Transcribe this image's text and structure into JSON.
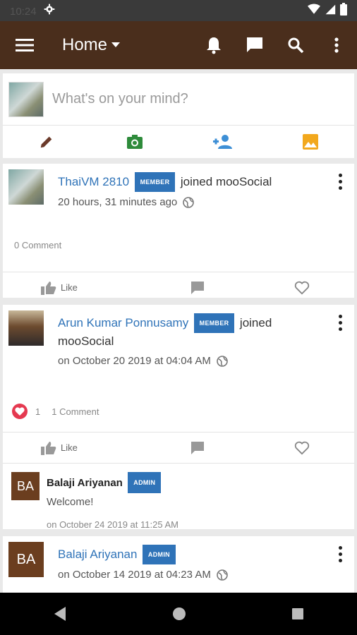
{
  "status_bar": {
    "time": "10:24"
  },
  "app_bar": {
    "title": "Home"
  },
  "composer": {
    "placeholder": "What's on your mind?"
  },
  "colors": {
    "app_bar": "#4a2e1c",
    "link": "#2f73b8",
    "badge": "#2f73b8",
    "avatar_ba": "#6b3e1f",
    "heart": "#e53950"
  },
  "posts": [
    {
      "author": "ThaiVM 2810",
      "badge": "MEMBER",
      "action": "joined mooSocial",
      "time": "20 hours, 31 minutes ago",
      "comment_count": "0 Comment",
      "like_label": "Like"
    },
    {
      "author": "Arun Kumar Ponnusamy",
      "badge": "MEMBER",
      "action": "joined mooSocial",
      "time": "on October 20 2019 at 04:04 AM",
      "reaction_count": "1",
      "comment_count": "1 Comment",
      "like_label": "Like",
      "comment": {
        "avatar": "BA",
        "author": "Balaji Ariyanan",
        "badge": "ADMIN",
        "text": "Welcome!",
        "time": "on October 24 2019 at 11:25 AM"
      }
    },
    {
      "avatar": "BA",
      "author": "Balaji Ariyanan",
      "badge": "ADMIN",
      "time": "on October 14 2019 at 04:23 AM"
    }
  ]
}
